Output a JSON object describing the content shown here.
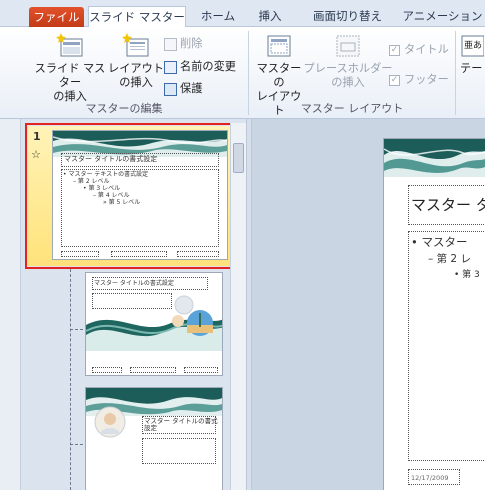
{
  "tabs": [
    {
      "label": "ファイル"
    },
    {
      "label": "スライド マスター"
    },
    {
      "label": "ホーム"
    },
    {
      "label": "挿入"
    },
    {
      "label": "画面切り替え"
    },
    {
      "label": "アニメーション"
    }
  ],
  "groups": {
    "edit_master": {
      "label": "マスターの編集",
      "insert_slide_master": "スライド マスター\nの挿入",
      "insert_layout": "レイアウト\nの挿入",
      "delete": "削除",
      "rename": "名前の変更",
      "preserve": "保護"
    },
    "master_layout": {
      "label": "マスター レイアウト",
      "master_layout_btn": "マスターの\nレイアウト",
      "insert_placeholder": "プレースホルダー\nの挿入",
      "title_chk": "タイトル",
      "footer_chk": "フッター"
    },
    "theme_partial": "テー"
  },
  "thumbnails": {
    "master_number": "1",
    "master_star": "☆",
    "master_title": "マスター タイトルの書式設定",
    "master_text_lines": [
      "• マスター テキストの書式設定",
      "– 第 2 レベル",
      "• 第 3 レベル",
      "– 第 4 レベル",
      "» 第 5 レベル"
    ],
    "layout1_title": "マスター タイトルの書式設定",
    "layout2_title": "マスター タイトルの書式\n設定"
  },
  "editor": {
    "title_partial": "マスター タ",
    "bullet1": "• マスター",
    "bullet2": "– 第 2 レ",
    "bullet3": "• 第 3",
    "date": "12/17/2009"
  }
}
